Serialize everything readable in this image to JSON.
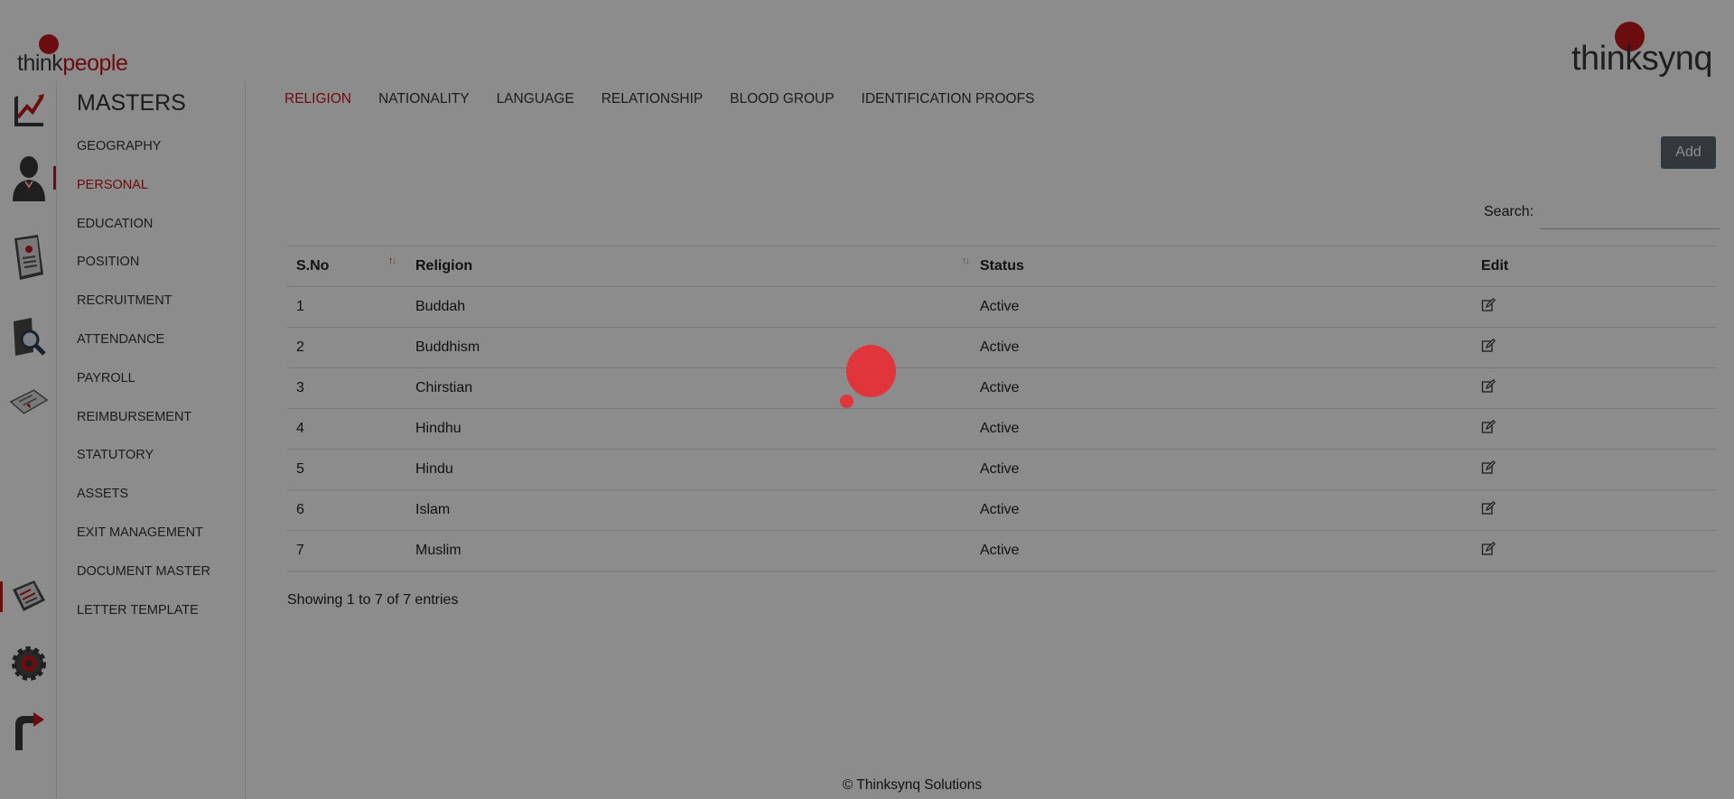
{
  "brand": {
    "left_logo_think": "think",
    "left_logo_people": "people",
    "right_logo": "thinksynq",
    "accent_color": "#c4161c"
  },
  "rail": {
    "icons": [
      "dashboard-chart-icon",
      "employee-icon",
      "profile-document-icon",
      "search-magnify-icon",
      "certificate-icon",
      "masters-document-icon",
      "settings-gear-icon",
      "logout-exit-icon"
    ]
  },
  "submenu": {
    "title": "MASTERS",
    "items": [
      {
        "label": "GEOGRAPHY"
      },
      {
        "label": "PERSONAL"
      },
      {
        "label": "EDUCATION"
      },
      {
        "label": "POSITION"
      },
      {
        "label": "RECRUITMENT"
      },
      {
        "label": "ATTENDANCE"
      },
      {
        "label": "PAYROLL"
      },
      {
        "label": "REIMBURSEMENT"
      },
      {
        "label": "STATUTORY"
      },
      {
        "label": "ASSETS"
      },
      {
        "label": "EXIT MANAGEMENT"
      },
      {
        "label": "DOCUMENT MASTER"
      },
      {
        "label": "LETTER TEMPLATE"
      }
    ],
    "active_index": 1
  },
  "tabs": [
    {
      "label": "RELIGION"
    },
    {
      "label": "NATIONALITY"
    },
    {
      "label": "LANGUAGE"
    },
    {
      "label": "RELATIONSHIP"
    },
    {
      "label": "BLOOD GROUP"
    },
    {
      "label": "IDENTIFICATION PROOFS"
    }
  ],
  "active_tab": 0,
  "toolbar": {
    "add_label": "Add"
  },
  "search": {
    "label": "Search:",
    "value": ""
  },
  "table": {
    "headers": {
      "sno": "S.No",
      "religion": "Religion",
      "status": "Status",
      "edit": "Edit"
    },
    "rows": [
      {
        "sno": "1",
        "religion": "Buddah",
        "status": "Active"
      },
      {
        "sno": "2",
        "religion": "Buddhism",
        "status": "Active"
      },
      {
        "sno": "3",
        "religion": "Chirstian",
        "status": "Active"
      },
      {
        "sno": "4",
        "religion": "Hindhu",
        "status": "Active"
      },
      {
        "sno": "5",
        "religion": "Hindu",
        "status": "Active"
      },
      {
        "sno": "6",
        "religion": "Islam",
        "status": "Active"
      },
      {
        "sno": "7",
        "religion": "Muslim",
        "status": "Active"
      }
    ],
    "info": "Showing 1 to 7 of 7 entries"
  },
  "footer": {
    "text": "© Thinksynq Solutions"
  },
  "loader": {
    "color": "#e0353b",
    "overlay_color": "rgba(0,0,0,0.45)"
  }
}
